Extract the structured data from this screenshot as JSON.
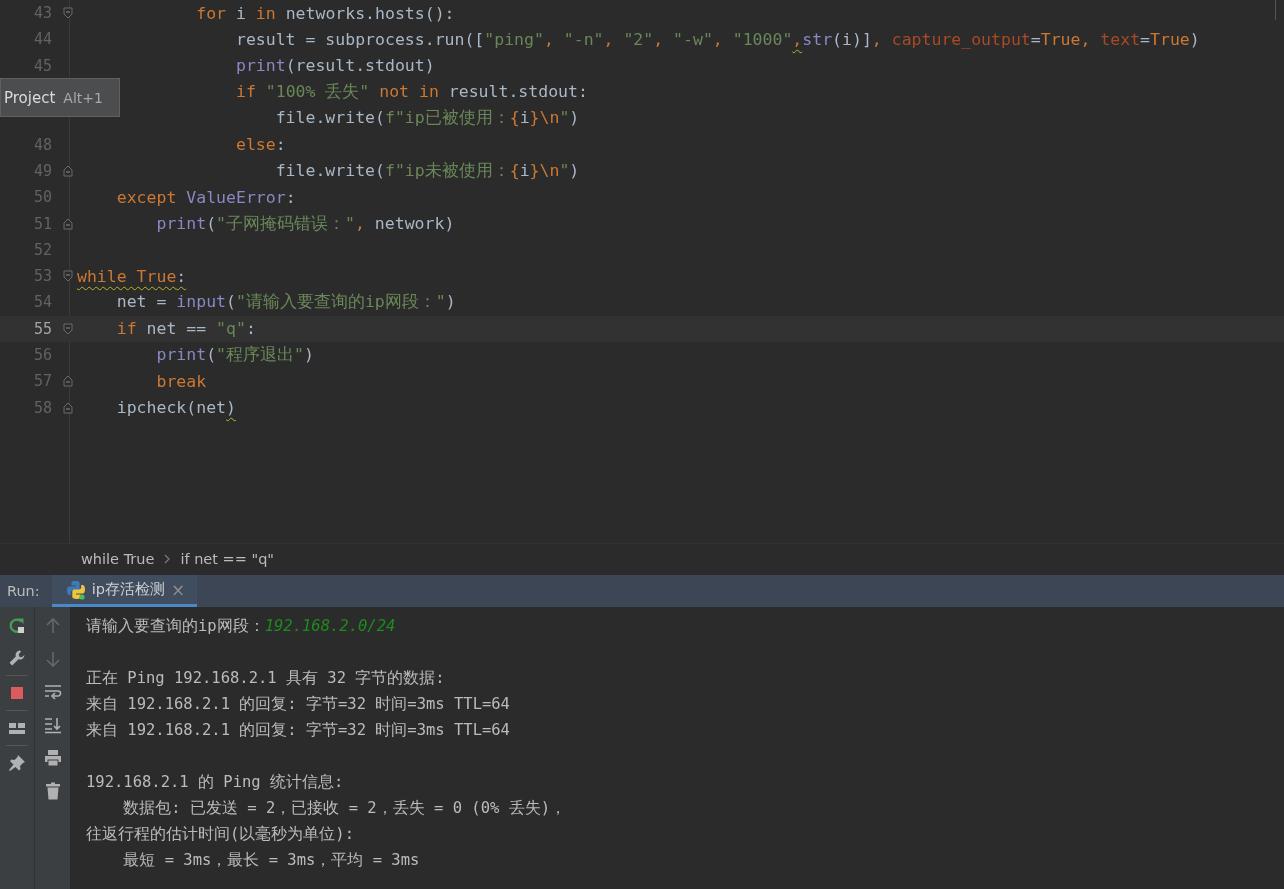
{
  "editor": {
    "lines": [
      {
        "number": "43",
        "kind": "fold-start",
        "tokens": [
          {
            "text": "            for",
            "kind": "keyword"
          },
          {
            "text": " i ",
            "kind": "plain"
          },
          {
            "text": "in",
            "kind": "keyword"
          },
          {
            "text": " networks.hosts():",
            "kind": "plain"
          }
        ]
      },
      {
        "number": "44",
        "tokens": [
          {
            "text": "                result = subprocess.run([",
            "kind": "plain"
          },
          {
            "text": "\"ping\"",
            "kind": "string"
          },
          {
            "text": ", ",
            "kind": "punct"
          },
          {
            "text": "\"-n\"",
            "kind": "string"
          },
          {
            "text": ", ",
            "kind": "punct"
          },
          {
            "text": "\"2\"",
            "kind": "string"
          },
          {
            "text": ", ",
            "kind": "punct"
          },
          {
            "text": "\"-w\"",
            "kind": "string"
          },
          {
            "text": ", ",
            "kind": "punct"
          },
          {
            "text": "\"1000\"",
            "kind": "string"
          },
          {
            "text": ",",
            "kind": "punct",
            "warning": true
          },
          {
            "text": "str",
            "kind": "builtin"
          },
          {
            "text": "(i)]",
            "kind": "plain"
          },
          {
            "text": ", ",
            "kind": "punct"
          },
          {
            "text": "capture_output",
            "kind": "param"
          },
          {
            "text": "=",
            "kind": "plain"
          },
          {
            "text": "True",
            "kind": "keyword"
          },
          {
            "text": ", ",
            "kind": "punct"
          },
          {
            "text": "text",
            "kind": "param"
          },
          {
            "text": "=",
            "kind": "plain"
          },
          {
            "text": "True",
            "kind": "keyword"
          },
          {
            "text": ")",
            "kind": "plain"
          }
        ]
      },
      {
        "number": "45",
        "tokens": [
          {
            "text": "                print",
            "kind": "builtin"
          },
          {
            "text": "(result.stdout)",
            "kind": "plain"
          }
        ]
      },
      {
        "tokens": [
          {
            "text": "                if ",
            "kind": "keyword"
          },
          {
            "text": "\"100% 丢失\" ",
            "kind": "string"
          },
          {
            "text": "not ",
            "kind": "keyword"
          },
          {
            "text": "in",
            "kind": "keyword"
          },
          {
            "text": " result.stdout:",
            "kind": "plain"
          }
        ]
      },
      {
        "tokens": [
          {
            "text": "                    file.write(",
            "kind": "plain"
          },
          {
            "text": "f\"ip已被使用：",
            "kind": "string"
          },
          {
            "text": "{",
            "kind": "keyword"
          },
          {
            "text": "i",
            "kind": "plain"
          },
          {
            "text": "}\\n",
            "kind": "keyword"
          },
          {
            "text": "\"",
            "kind": "string"
          },
          {
            "text": ")",
            "kind": "plain"
          }
        ]
      },
      {
        "number": "48",
        "tokens": [
          {
            "text": "                else",
            "kind": "keyword"
          },
          {
            "text": ":",
            "kind": "plain"
          }
        ]
      },
      {
        "number": "49",
        "kind": "fold-end",
        "tokens": [
          {
            "text": "                    file.write(",
            "kind": "plain"
          },
          {
            "text": "f\"ip未被使用：",
            "kind": "string"
          },
          {
            "text": "{",
            "kind": "keyword"
          },
          {
            "text": "i",
            "kind": "plain"
          },
          {
            "text": "}\\n",
            "kind": "keyword"
          },
          {
            "text": "\"",
            "kind": "string"
          },
          {
            "text": ")",
            "kind": "plain"
          }
        ]
      },
      {
        "number": "50",
        "tokens": [
          {
            "text": "    except ",
            "kind": "keyword"
          },
          {
            "text": "ValueError",
            "kind": "builtin"
          },
          {
            "text": ":",
            "kind": "plain"
          }
        ]
      },
      {
        "number": "51",
        "kind": "fold-end",
        "tokens": [
          {
            "text": "        print",
            "kind": "builtin"
          },
          {
            "text": "(",
            "kind": "plain"
          },
          {
            "text": "\"子网掩码错误：\"",
            "kind": "string"
          },
          {
            "text": ", ",
            "kind": "punct"
          },
          {
            "text": "network)",
            "kind": "plain"
          }
        ]
      },
      {
        "number": "52"
      },
      {
        "number": "53",
        "kind": "fold-start",
        "tokens": [
          {
            "text": "while True",
            "kind": "keyword",
            "warning": true
          },
          {
            "text": ":",
            "kind": "plain",
            "warning": true
          }
        ]
      },
      {
        "number": "54",
        "tokens": [
          {
            "text": "    net = ",
            "kind": "plain"
          },
          {
            "text": "input",
            "kind": "builtin"
          },
          {
            "text": "(",
            "kind": "plain"
          },
          {
            "text": "\"请输入要查询的ip网段：\"",
            "kind": "string"
          },
          {
            "text": ")",
            "kind": "plain"
          }
        ]
      },
      {
        "number": "55",
        "kind": "fold-start",
        "current": true,
        "tokens": [
          {
            "text": "    if",
            "kind": "keyword"
          },
          {
            "text": " net == ",
            "kind": "plain"
          },
          {
            "text": "\"q\"",
            "kind": "string"
          },
          {
            "text": ":",
            "kind": "plain"
          }
        ]
      },
      {
        "number": "56",
        "tokens": [
          {
            "text": "        print",
            "kind": "builtin"
          },
          {
            "text": "(",
            "kind": "plain"
          },
          {
            "text": "\"程序退出\"",
            "kind": "string"
          },
          {
            "text": ")",
            "kind": "plain"
          }
        ]
      },
      {
        "number": "57",
        "kind": "fold-end",
        "tokens": [
          {
            "text": "        break",
            "kind": "keyword"
          }
        ]
      },
      {
        "number": "58",
        "kind": "fold-end",
        "tokens": [
          {
            "text": "    ipcheck(net",
            "kind": "plain"
          },
          {
            "text": ")",
            "kind": "plain",
            "warning": true
          }
        ]
      }
    ]
  },
  "tooltip": {
    "label": "Project",
    "shortcut": "Alt+1"
  },
  "breadcrumbs": [
    "while True",
    "if net == \"q\""
  ],
  "run_panel": {
    "label": "Run:",
    "tabs": [
      {
        "title": "ip存活检测",
        "selected": true,
        "close": "×"
      }
    ],
    "toolbar": [
      {
        "kind": "up",
        "disabled": true
      },
      {
        "kind": "down",
        "disabled": true
      },
      {
        "kind": "wrap",
        "disabled": false
      },
      {
        "kind": "scroll-end",
        "disabled": false
      },
      {
        "kind": "print",
        "disabled": false
      },
      {
        "kind": "delete",
        "disabled": false
      }
    ],
    "console": [
      {
        "parts": [
          {
            "text": "请输入要查询的ip网段：",
            "kind": "output"
          },
          {
            "text": "192.168.2.0/24",
            "kind": "input"
          }
        ]
      },
      {
        "gap_before": true,
        "parts": [
          {
            "text": "正在 Ping 192.168.2.1 具有 32 字节的数据:",
            "kind": "output"
          }
        ]
      },
      {
        "parts": [
          {
            "text": "来自 192.168.2.1 的回复: 字节=32 时间=3ms TTL=64",
            "kind": "output"
          }
        ]
      },
      {
        "parts": [
          {
            "text": "来自 192.168.2.1 的回复: 字节=32 时间=3ms TTL=64",
            "kind": "output"
          }
        ]
      },
      {
        "gap_before": true,
        "parts": [
          {
            "text": "192.168.2.1 的 Ping 统计信息:",
            "kind": "output"
          }
        ]
      },
      {
        "parts": [
          {
            "text": "    数据包: 已发送 = 2，已接收 = 2，丢失 = 0 (0% 丢失)，",
            "kind": "output"
          }
        ]
      },
      {
        "parts": [
          {
            "text": "往返行程的估计时间(以毫秒为单位):",
            "kind": "output"
          }
        ]
      },
      {
        "parts": [
          {
            "text": "    最短 = 3ms，最长 = 3ms，平均 = 3ms",
            "kind": "output"
          }
        ]
      }
    ]
  }
}
